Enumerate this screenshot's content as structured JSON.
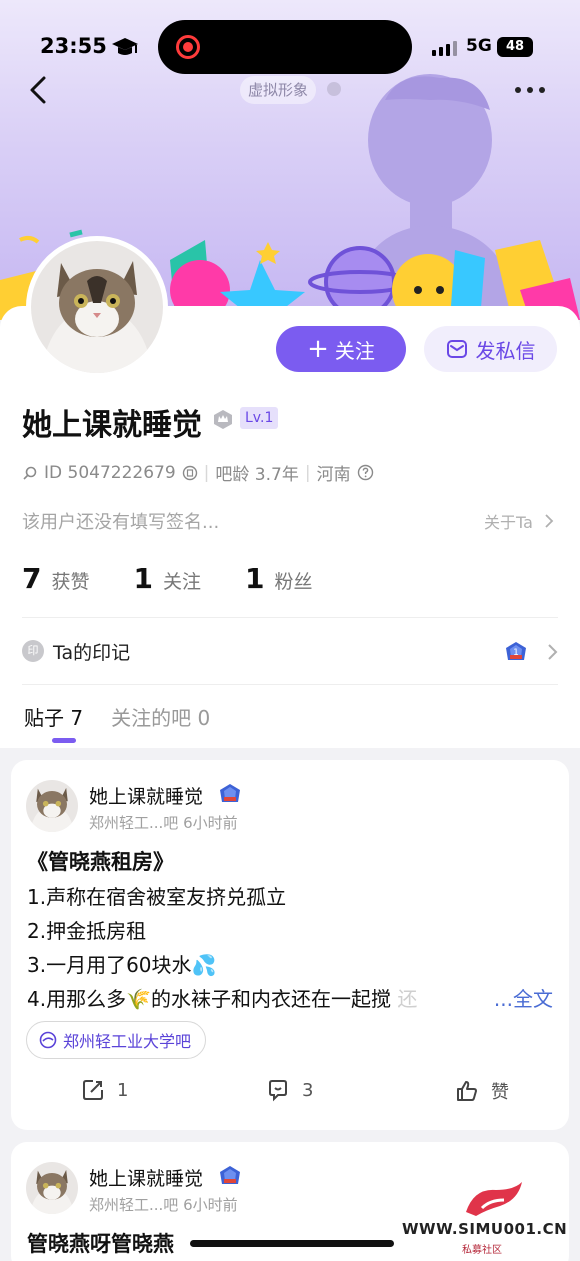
{
  "status_bar": {
    "time": "23:55",
    "network": "5G",
    "battery": "48"
  },
  "header": {
    "avatar_mode": "虚拟形象"
  },
  "profile": {
    "username": "她上课就睡觉",
    "level": "Lv.1",
    "id_label": "ID 5047222679",
    "bar_age": "吧龄 3.7年",
    "location": "河南",
    "signature": "该用户还没有填写签名...",
    "about": "关于Ta",
    "stats": [
      {
        "num": "7",
        "label": "获赞"
      },
      {
        "num": "1",
        "label": "关注"
      },
      {
        "num": "1",
        "label": "粉丝"
      }
    ],
    "follow_label": "关注",
    "message_label": "发私信",
    "mark_icon_text": "印",
    "mark_label": "Ta的印记"
  },
  "tabs": [
    {
      "label": "贴子 7"
    },
    {
      "label": "关注的吧 0"
    }
  ],
  "posts": [
    {
      "author": "她上课就睡觉",
      "forum_time": "郑州轻工...吧   6小时前",
      "title": "《管晓燕租房》",
      "lines": [
        "1.声称在宿舍被室友挤兑孤立",
        "2.押金抵房租",
        "3.一月用了60块水💦",
        "4.用那么多🌾的水袜子和内衣还在一起搅"
      ],
      "line4_fade": "还",
      "more": "...全文",
      "forum": "郑州轻工业大学吧",
      "comments": "1",
      "replies": "3",
      "like": "赞"
    },
    {
      "author": "她上课就睡觉",
      "forum_time": "郑州轻工...吧   6小时前",
      "title": "管晓燕呀管晓燕"
    }
  ],
  "watermark": {
    "text": "WWW.SIMU001.CN",
    "sub": "私募社区"
  },
  "colors": {
    "accent": "#7b5cf0",
    "link": "#4a6cd4",
    "banner": "#d9cff6"
  }
}
